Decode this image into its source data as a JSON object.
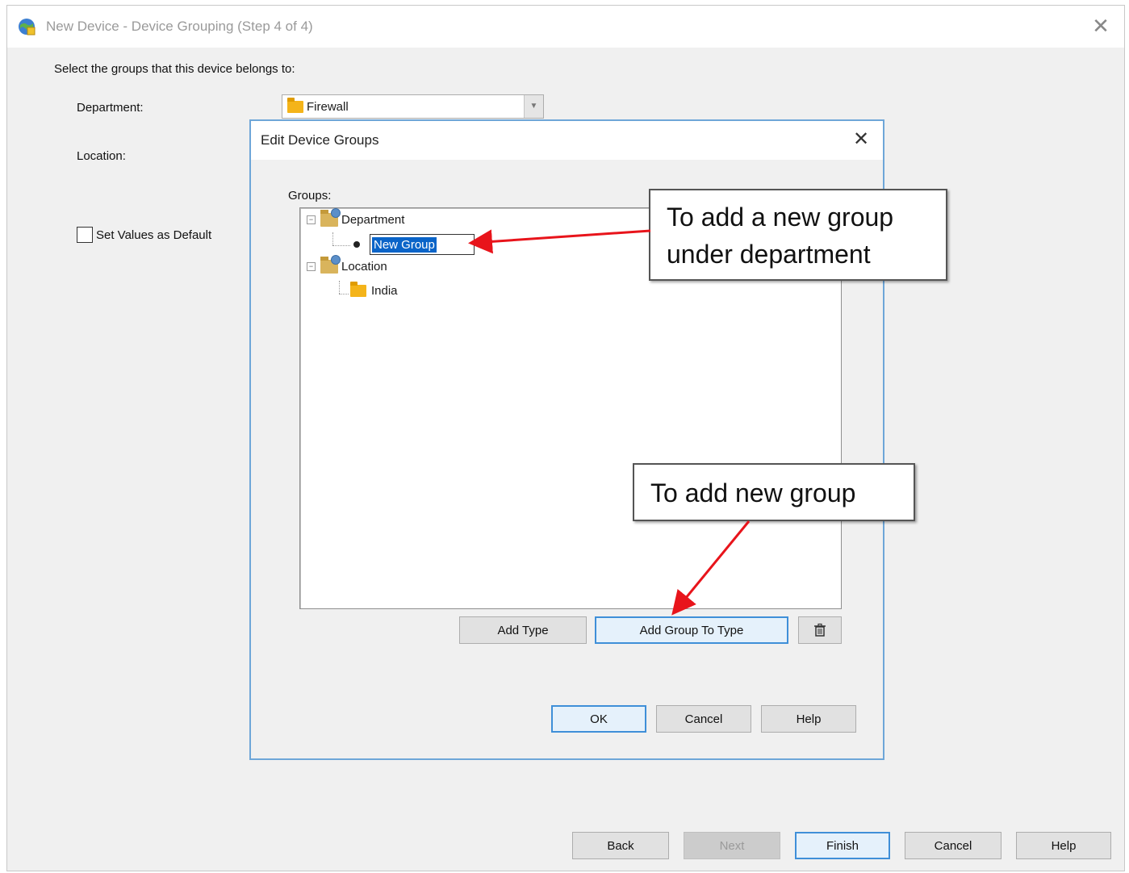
{
  "window": {
    "title": "New Device - Device Grouping (Step 4 of 4)",
    "close_glyph": "✕"
  },
  "form": {
    "instruction": "Select the groups that this device belongs to:",
    "department_label": "Department:",
    "department_value": "Firewall",
    "location_label": "Location:",
    "set_default_label": "Set Values as Default"
  },
  "dialog": {
    "title": "Edit Device Groups",
    "close_glyph": "✕",
    "groups_label": "Groups:",
    "tree": [
      {
        "label": "Department",
        "type": "type",
        "expanded": true
      },
      {
        "label": "New Group",
        "type": "group-editing",
        "parent": "Department"
      },
      {
        "label": "Location",
        "type": "type",
        "expanded": true
      },
      {
        "label": "India",
        "type": "group",
        "parent": "Location"
      }
    ],
    "buttons": {
      "add_type": "Add Type",
      "add_group_to_type": "Add Group To Type",
      "delete_icon": "trash-icon",
      "ok": "OK",
      "cancel": "Cancel",
      "help": "Help"
    }
  },
  "wizard_buttons": {
    "back": "Back",
    "next": "Next",
    "finish": "Finish",
    "cancel": "Cancel",
    "help": "Help"
  },
  "annotations": {
    "callout_1_line1": "To add a new group",
    "callout_1_line2": "under department",
    "callout_2": "To add new group",
    "arrow_color": "#e8141b"
  },
  "colors": {
    "accent": "#3f8fd8",
    "selection": "#0a64c8",
    "folder": "#f4b41a"
  }
}
